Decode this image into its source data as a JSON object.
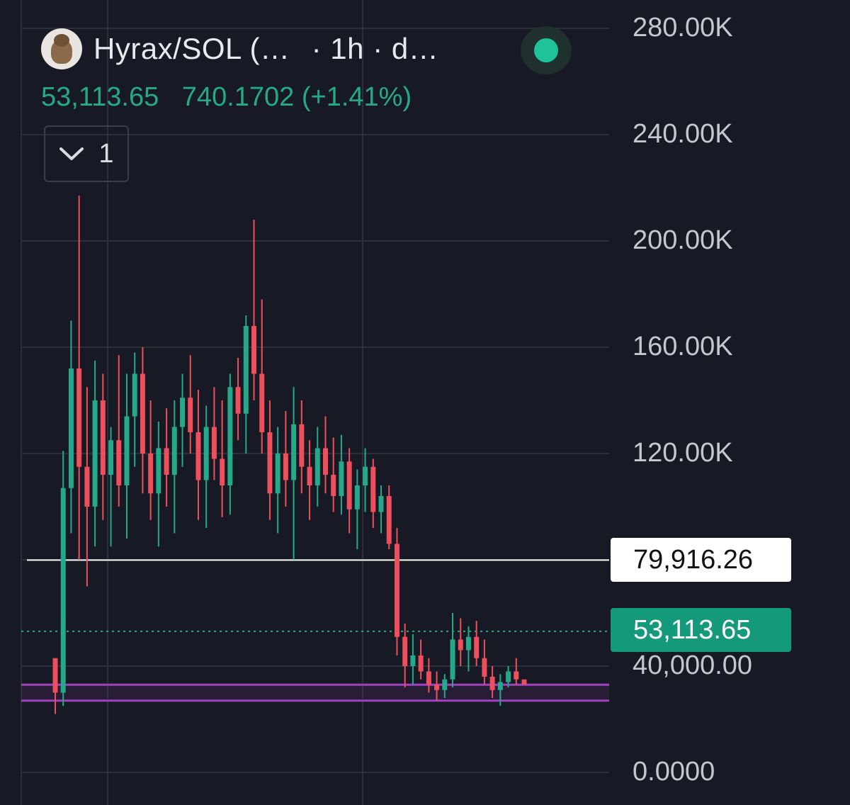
{
  "header": {
    "pair_title": "Hyrax/SOL (…",
    "interval": "· 1h · d…",
    "last_price": "53,113.65",
    "change": "740.1702 (+1.41%)",
    "indicators_count": "1"
  },
  "colors": {
    "background": "#171a24",
    "grid": "#2b2f3a",
    "up": "#26a98b",
    "down": "#ef4f5c",
    "hline": "#ffffff",
    "zone": "#a040c0",
    "price_tag": "#149a7b"
  },
  "icons": {
    "live_status": "green-dot-icon",
    "collapse": "chevron-down-icon",
    "avatar": "hyrax-avatar-icon"
  },
  "chart_data": {
    "type": "candlestick",
    "y_axis_labels": [
      "280.00K",
      "240.00K",
      "200.00K",
      "160.00K",
      "120.00K",
      "40,000.00",
      "0.0000"
    ],
    "y_axis_values": [
      280000,
      240000,
      200000,
      160000,
      120000,
      40000,
      0
    ],
    "ylim": [
      0,
      280000
    ],
    "grid": true,
    "horizontal_line": {
      "value": 79916.26,
      "label": "79,916.26"
    },
    "current_price": {
      "value": 53113.65,
      "label": "53,113.65"
    },
    "support_zone": {
      "low": 27000,
      "high": 33000
    },
    "ohlc": [
      [
        43000,
        43000,
        22000,
        30000
      ],
      [
        30000,
        121000,
        25000,
        107000
      ],
      [
        107000,
        170000,
        90000,
        152000
      ],
      [
        152000,
        217000,
        80000,
        115000
      ],
      [
        115000,
        145000,
        70000,
        100000
      ],
      [
        100000,
        155000,
        85000,
        140000
      ],
      [
        140000,
        150000,
        95000,
        112000
      ],
      [
        112000,
        130000,
        85000,
        125000
      ],
      [
        125000,
        157000,
        100000,
        108000
      ],
      [
        108000,
        150000,
        88000,
        134000
      ],
      [
        134000,
        158000,
        115000,
        150000
      ],
      [
        150000,
        160000,
        105000,
        120000
      ],
      [
        120000,
        140000,
        95000,
        105000
      ],
      [
        105000,
        132000,
        85000,
        122000
      ],
      [
        122000,
        137000,
        100000,
        112000
      ],
      [
        112000,
        140000,
        90000,
        130000
      ],
      [
        130000,
        150000,
        115000,
        141000
      ],
      [
        141000,
        157000,
        120000,
        128000
      ],
      [
        128000,
        144000,
        95000,
        110000
      ],
      [
        110000,
        138000,
        92000,
        130000
      ],
      [
        130000,
        145000,
        110000,
        118000
      ],
      [
        118000,
        140000,
        96000,
        108000
      ],
      [
        108000,
        150000,
        97000,
        145000
      ],
      [
        145000,
        156000,
        125000,
        135000
      ],
      [
        135000,
        172000,
        120000,
        168000
      ],
      [
        168000,
        208000,
        140000,
        150000
      ],
      [
        150000,
        178000,
        120000,
        128000
      ],
      [
        128000,
        140000,
        95000,
        105000
      ],
      [
        105000,
        130000,
        90000,
        120000
      ],
      [
        120000,
        136000,
        100000,
        110000
      ],
      [
        110000,
        145000,
        80000,
        131000
      ],
      [
        131000,
        140000,
        105000,
        115000
      ],
      [
        115000,
        125000,
        95000,
        108000
      ],
      [
        108000,
        130000,
        100000,
        122000
      ],
      [
        122000,
        134000,
        105000,
        112000
      ],
      [
        112000,
        126000,
        98000,
        104000
      ],
      [
        104000,
        127000,
        97000,
        117000
      ],
      [
        117000,
        122000,
        90000,
        99000
      ],
      [
        99000,
        114000,
        84000,
        108000
      ],
      [
        108000,
        122000,
        98000,
        115000
      ],
      [
        115000,
        118000,
        92000,
        98000
      ],
      [
        98000,
        108000,
        90000,
        104000
      ],
      [
        104000,
        108000,
        84000,
        86000
      ],
      [
        86000,
        92000,
        44000,
        51000
      ],
      [
        51000,
        56000,
        32000,
        40000
      ],
      [
        40000,
        52000,
        33000,
        44000
      ],
      [
        44000,
        50000,
        35000,
        38000
      ],
      [
        38000,
        43000,
        30000,
        33000
      ],
      [
        33000,
        38000,
        27000,
        31000
      ],
      [
        31000,
        37000,
        28000,
        35000
      ],
      [
        35000,
        60000,
        32000,
        50000
      ],
      [
        50000,
        58000,
        40000,
        46000
      ],
      [
        46000,
        55000,
        38000,
        51000
      ],
      [
        51000,
        57000,
        40000,
        43000
      ],
      [
        43000,
        50000,
        33000,
        36000
      ],
      [
        36000,
        40000,
        28000,
        31000
      ],
      [
        31000,
        37000,
        25000,
        34000
      ],
      [
        34000,
        40000,
        32000,
        38000
      ],
      [
        38000,
        43000,
        33000,
        35000
      ],
      [
        35000,
        33000,
        33000,
        33000
      ]
    ]
  }
}
